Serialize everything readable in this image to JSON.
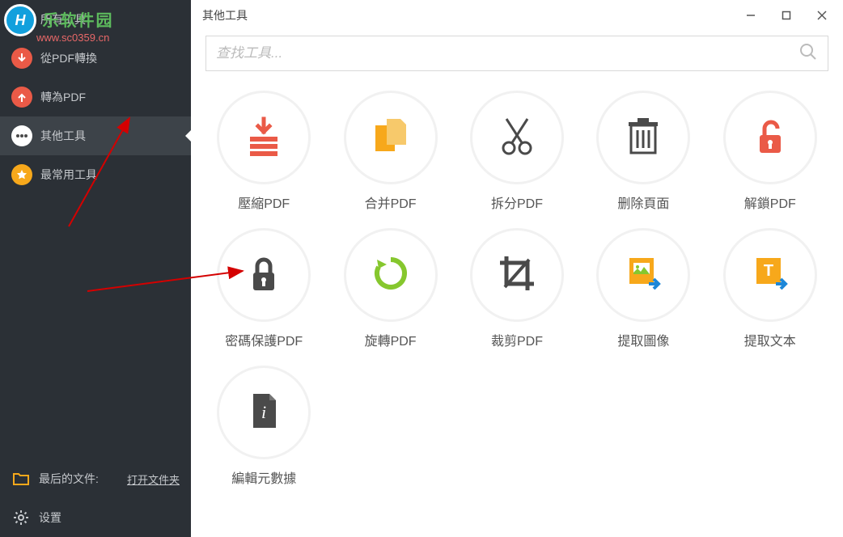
{
  "watermark": {
    "brand": "乐软件园",
    "url": "www.sc0359.cn",
    "logo_letter": "H"
  },
  "sidebar": {
    "items": [
      {
        "label": "所有工具"
      },
      {
        "label": "從PDF轉換"
      },
      {
        "label": "轉為PDF"
      },
      {
        "label": "其他工具"
      },
      {
        "label": "最常用工具"
      }
    ],
    "active_index": 3,
    "last_files_label": "最后的文件:",
    "open_folder_label": "打开文件夹",
    "settings_label": "设置"
  },
  "main": {
    "title": "其他工具",
    "search_placeholder": "查找工具...",
    "tools": [
      {
        "label": "壓縮PDF"
      },
      {
        "label": "合并PDF"
      },
      {
        "label": "拆分PDF"
      },
      {
        "label": "删除頁面"
      },
      {
        "label": "解鎖PDF"
      },
      {
        "label": "密碼保護PDF"
      },
      {
        "label": "旋轉PDF"
      },
      {
        "label": "裁剪PDF"
      },
      {
        "label": "提取圖像"
      },
      {
        "label": "提取文本"
      },
      {
        "label": "編輯元數據"
      }
    ]
  },
  "colors": {
    "orange_red": "#ea5a47",
    "amber": "#f7a81b",
    "dark": "#4a4a4a",
    "green": "#86c72e",
    "blue_accent": "#1d87d8"
  }
}
